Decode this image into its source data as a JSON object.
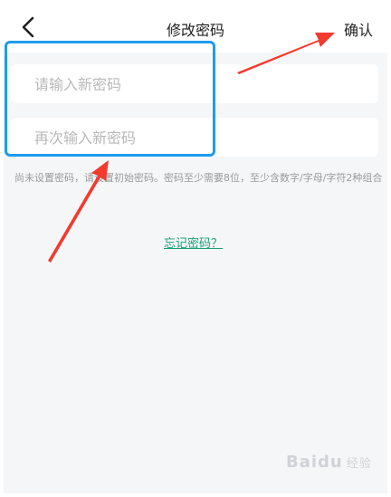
{
  "header": {
    "title": "修改密码",
    "confirm_label": "确认"
  },
  "form": {
    "new_password_placeholder": "请输入新密码",
    "confirm_password_placeholder": "再次输入新密码",
    "hint_text": "尚未设置密码，请设置初始密码。密码至少需要8位，至少含数字/字母/字符2种组合",
    "forgot_label": "忘记密码？"
  },
  "watermark": {
    "brand": "Baidu",
    "sub": "经验"
  },
  "colors": {
    "accent_link": "#1aa179",
    "highlight_border": "#1e9cf0",
    "arrow": "#f23a2e",
    "background": "#f5f6f7"
  },
  "icons": {
    "back": "chevron-left-icon"
  }
}
